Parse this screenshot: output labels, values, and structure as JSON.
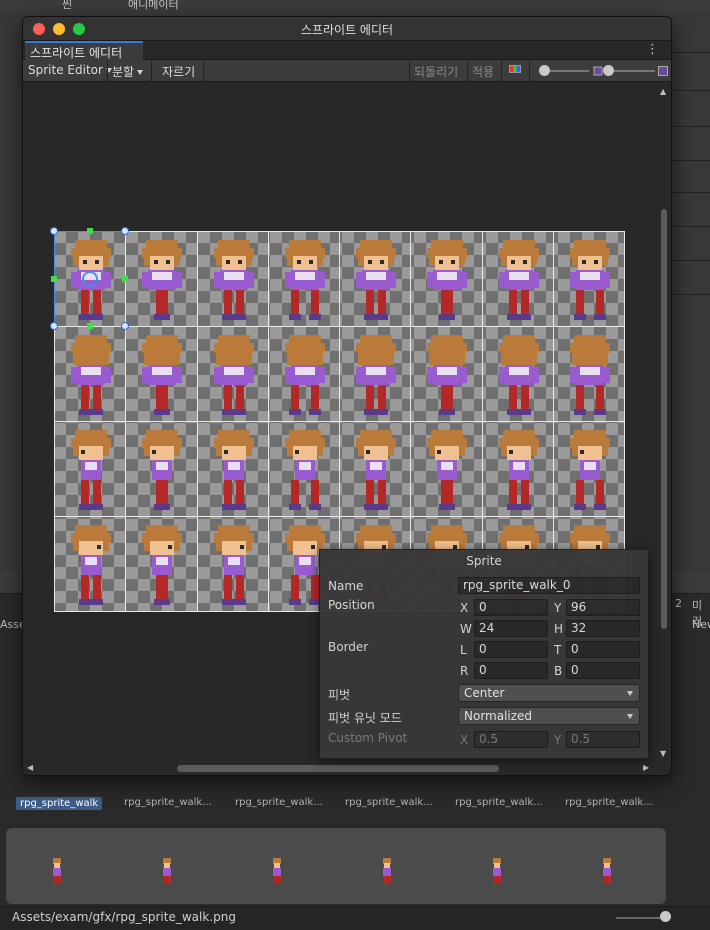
{
  "background": {
    "top_tabs": [
      "씬",
      "애니메이터"
    ],
    "side_labels": [
      "Asse",
      "미러",
      "New"
    ],
    "right_badge": "2",
    "assets": {
      "selected": "rpg_sprite_walk",
      "items": [
        "rpg_sprite_walk...",
        "rpg_sprite_walk...",
        "rpg_sprite_walk...",
        "rpg_sprite_walk...",
        "rpg_sprite_walk..."
      ]
    },
    "status_path": "Assets/exam/gfx/rpg_sprite_walk.png"
  },
  "window": {
    "title": "스프라이트 에디터",
    "tab_label": "스프라이트 에디터",
    "toolbar": {
      "mode_label": "Sprite Editor",
      "slice_label": "분할",
      "trim_label": "자르기",
      "revert_label": "되돌리기",
      "apply_label": "적용"
    }
  },
  "sheet": {
    "columns": 8,
    "rows": 4,
    "row_facing": [
      "front",
      "back",
      "left",
      "right"
    ],
    "selected_cell": "0,0"
  },
  "sprite_panel": {
    "title": "Sprite",
    "name_label": "Name",
    "name_value": "rpg_sprite_walk_0",
    "position_label": "Position",
    "x_label": "X",
    "x_value": "0",
    "y_label": "Y",
    "y_value": "96",
    "w_label": "W",
    "w_value": "24",
    "h_label": "H",
    "h_value": "32",
    "border_label": "Border",
    "l_label": "L",
    "l_value": "0",
    "t_label": "T",
    "t_value": "0",
    "r_label": "R",
    "r_value": "0",
    "b_label": "B",
    "b_value": "0",
    "pivot_label": "피벗",
    "pivot_value": "Center",
    "pivot_unit_label": "피벗 유닛 모드",
    "pivot_unit_value": "Normalized",
    "custom_pivot_label": "Custom Pivot",
    "cp_x_label": "X",
    "cp_x_value": "0.5",
    "cp_y_label": "Y",
    "cp_y_value": "0.5"
  },
  "colors": {
    "accent": "#3a7ad6",
    "hair": "#b97a3a",
    "shirt": "#9a5ad0",
    "pants": "#b42828",
    "skin": "#f0c090"
  }
}
